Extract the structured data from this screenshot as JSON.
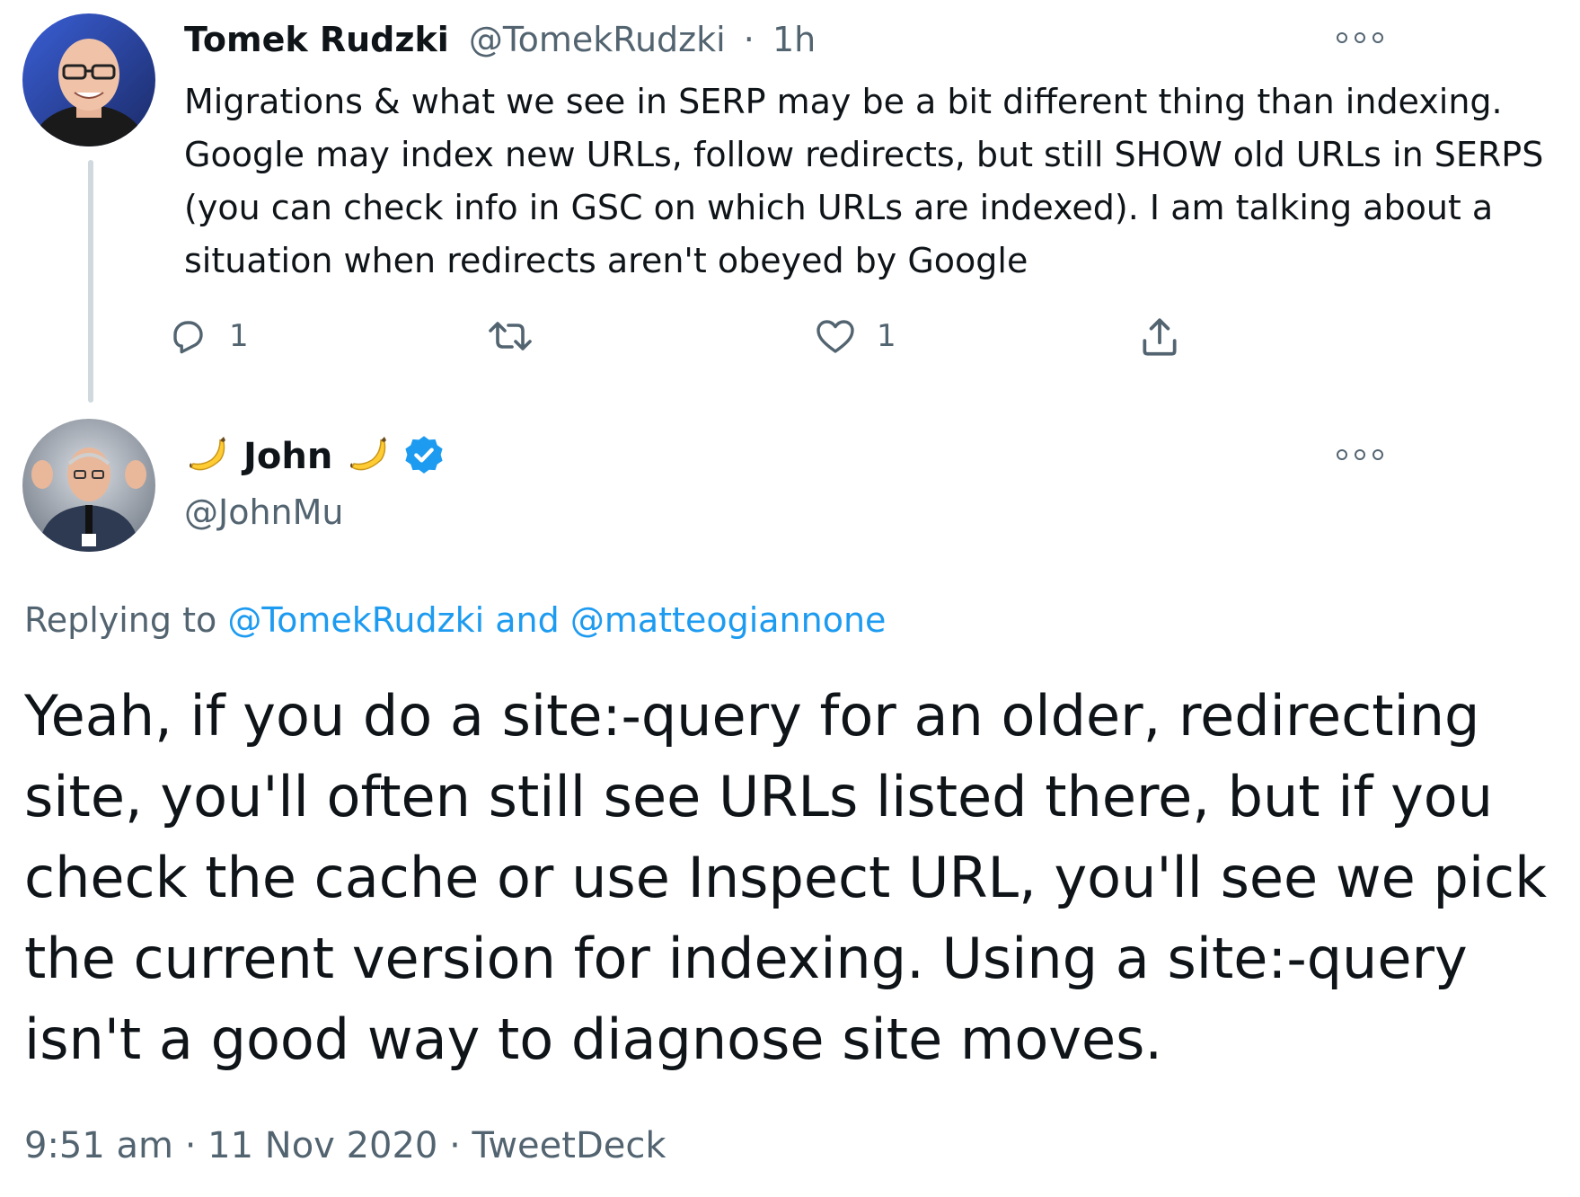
{
  "tweet1": {
    "author_name": "Tomek Rudzki",
    "author_handle": "@TomekRudzki",
    "separator": "·",
    "time_ago": "1h",
    "text": "Migrations & what we see in SERP may be a bit different thing than indexing. Google may index new URLs, follow redirects, but still SHOW old URLs in SERPS (you can check info in GSC on which URLs are indexed).  I am talking about a situation when redirects aren't obeyed by Google",
    "actions": {
      "reply_count": "1",
      "retweet_count": "",
      "like_count": "1"
    }
  },
  "tweet2": {
    "author_name": "John",
    "author_handle": "@JohnMu",
    "name_emoji": "banana-icon",
    "verified": true,
    "replying_prefix": "Replying to",
    "replying_user1": "@TomekRudzki",
    "replying_and": "and",
    "replying_user2": "@matteogiannone",
    "text": "Yeah, if you do a site:-query for an older, redirecting site, you'll often still see URLs listed there, but if you check the cache or use Inspect URL, you'll see we pick the current version for indexing. Using a site:-query isn't a good way to diagnose site moves.",
    "time": "9:51 am",
    "sep1": "·",
    "date": "11 Nov 2020",
    "sep2": "·",
    "source": "TweetDeck"
  },
  "colors": {
    "text": "#0f1419",
    "muted": "#536471",
    "link": "#1d9bf0",
    "verified": "#1d9bf0",
    "thread_line": "#cfd9de"
  }
}
